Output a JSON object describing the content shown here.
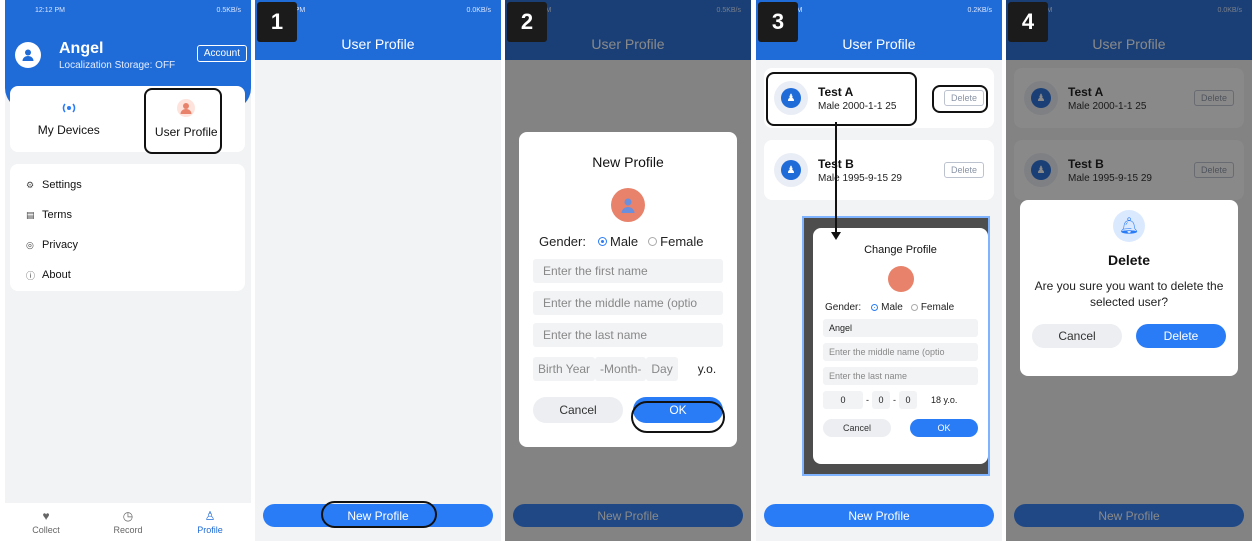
{
  "colors": {
    "primary": "#1f6bd8",
    "button": "#2a7cf6",
    "avatar_orange": "#e8826a"
  },
  "steps": [
    "1",
    "2",
    "3",
    "4"
  ],
  "status_bars": [
    {
      "time": "12:12 PM",
      "speed": "0.5KB/s"
    },
    {
      "time": "58 PM",
      "speed": "0.0KB/s"
    },
    {
      "time": "8 PM",
      "speed": "0.5KB/s"
    },
    {
      "time": "9 PM",
      "speed": "0.2KB/s"
    },
    {
      "time": "9 PM",
      "speed": "0.0KB/s"
    }
  ],
  "panel0": {
    "user_name": "Angel",
    "storage": "Localization Storage: OFF",
    "account": "Account",
    "devices": "My Devices",
    "user_profile": "User Profile",
    "menu": [
      {
        "icon": "gear-icon",
        "label": "Settings"
      },
      {
        "icon": "document-icon",
        "label": "Terms"
      },
      {
        "icon": "shield-icon",
        "label": "Privacy"
      },
      {
        "icon": "info-icon",
        "label": "About"
      }
    ],
    "tabs": [
      {
        "icon": "heart-icon",
        "label": "Collect"
      },
      {
        "icon": "clock-icon",
        "label": "Record"
      },
      {
        "icon": "person-icon",
        "label": "Profile"
      }
    ]
  },
  "page_title": "User Profile",
  "new_profile_button": "New Profile",
  "new_profile_dialog": {
    "title": "New Profile",
    "gender_label": "Gender:",
    "male": "Male",
    "female": "Female",
    "first_name_placeholder": "Enter the first name",
    "middle_name_placeholder": "Enter the middle name (optio",
    "last_name_placeholder": "Enter the last name",
    "birth_year": "Birth Year",
    "month": "-Month-",
    "day": "Day",
    "yo": "y.o.",
    "cancel": "Cancel",
    "ok": "OK"
  },
  "profiles": [
    {
      "name": "Test A",
      "info": "Male  2000-1-1  25",
      "delete": "Delete"
    },
    {
      "name": "Test B",
      "info": "Male  1995-9-15  29",
      "delete": "Delete"
    }
  ],
  "change_profile_dialog": {
    "title": "Change Profile",
    "gender_label": "Gender:",
    "male": "Male",
    "female": "Female",
    "first_name": "Angel",
    "middle_name_placeholder": "Enter the middle name (optio",
    "last_name_placeholder": "Enter the last name",
    "year": "0",
    "month": "0",
    "day": "0",
    "yo": "18 y.o.",
    "cancel": "Cancel",
    "ok": "OK"
  },
  "delete_dialog": {
    "title": "Delete",
    "message": "Are you sure you want to delete the selected user?",
    "cancel": "Cancel",
    "confirm": "Delete"
  }
}
